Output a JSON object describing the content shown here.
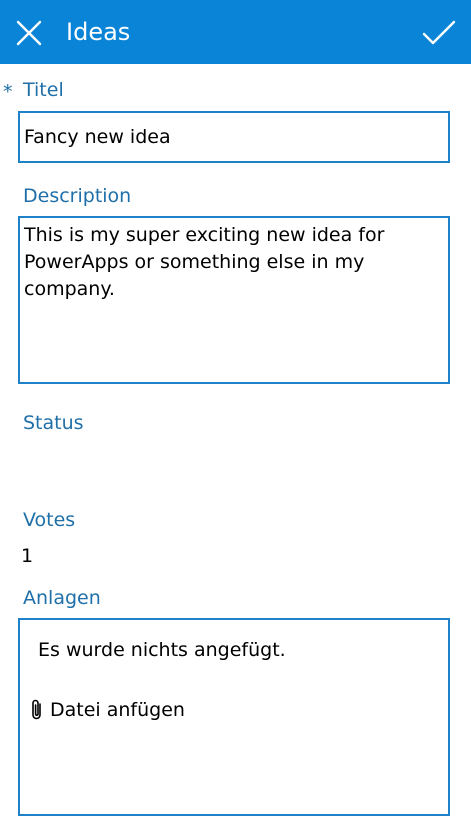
{
  "header": {
    "title": "Ideas",
    "close_icon": "close-icon",
    "confirm_icon": "checkmark-icon",
    "background": "#0a84d6"
  },
  "form": {
    "required_marker": "*",
    "title_field": {
      "label": "Titel",
      "value": "Fancy new idea"
    },
    "description_field": {
      "label": "Description",
      "value": "This is my super exciting new idea for PowerApps or something else in my company."
    },
    "status_field": {
      "label": "Status",
      "value": ""
    },
    "votes_field": {
      "label": "Votes",
      "value": "1"
    },
    "attachments_field": {
      "label": "Anlagen",
      "empty_text": "Es wurde nichts angefügt.",
      "add_label": "Datei anfügen",
      "add_icon": "paperclip-icon"
    }
  },
  "colors": {
    "label": "#1f6fa8",
    "input_border": "#1d82c9"
  }
}
